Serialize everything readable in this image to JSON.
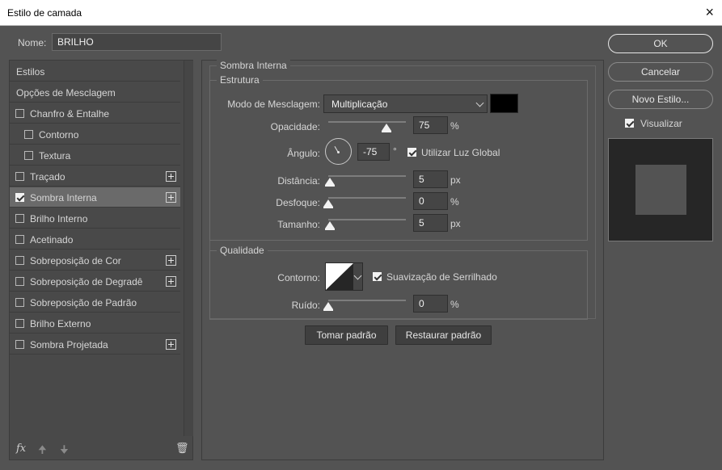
{
  "window": {
    "title": "Estilo de camada",
    "close_icon": "×"
  },
  "name_row": {
    "label": "Nome:",
    "value": "BRILHO"
  },
  "styles_list": [
    {
      "label": "Estilos",
      "checkbox": false,
      "checked": false,
      "plus": false,
      "indent": 0
    },
    {
      "label": "Opções de Mesclagem",
      "checkbox": false,
      "checked": false,
      "plus": false,
      "indent": 0
    },
    {
      "label": "Chanfro & Entalhe",
      "checkbox": true,
      "checked": false,
      "plus": false,
      "indent": 0
    },
    {
      "label": "Contorno",
      "checkbox": true,
      "checked": false,
      "plus": false,
      "indent": 1
    },
    {
      "label": "Textura",
      "checkbox": true,
      "checked": false,
      "plus": false,
      "indent": 1
    },
    {
      "label": "Traçado",
      "checkbox": true,
      "checked": false,
      "plus": true,
      "indent": 0
    },
    {
      "label": "Sombra Interna",
      "checkbox": true,
      "checked": true,
      "plus": true,
      "indent": 0,
      "selected": true
    },
    {
      "label": "Brilho Interno",
      "checkbox": true,
      "checked": false,
      "plus": false,
      "indent": 0
    },
    {
      "label": "Acetinado",
      "checkbox": true,
      "checked": false,
      "plus": false,
      "indent": 0
    },
    {
      "label": "Sobreposição de Cor",
      "checkbox": true,
      "checked": false,
      "plus": true,
      "indent": 0
    },
    {
      "label": "Sobreposição de Degradê",
      "checkbox": true,
      "checked": false,
      "plus": true,
      "indent": 0
    },
    {
      "label": "Sobreposição de Padrão",
      "checkbox": true,
      "checked": false,
      "plus": false,
      "indent": 0
    },
    {
      "label": "Brilho Externo",
      "checkbox": true,
      "checked": false,
      "plus": false,
      "indent": 0
    },
    {
      "label": "Sombra Projetada",
      "checkbox": true,
      "checked": false,
      "plus": true,
      "indent": 0
    }
  ],
  "bottom_icons": {
    "fx": "fx",
    "up": "🠉",
    "down": "🠋",
    "trash": "🗑"
  },
  "section": {
    "title": "Sombra Interna",
    "structure": {
      "title": "Estrutura",
      "blend_mode_label": "Modo de Mesclagem:",
      "blend_mode_value": "Multiplicação",
      "color_swatch": "#000000",
      "opacity_label": "Opacidade:",
      "opacity_value": "75",
      "opacity_unit": "%",
      "opacity_level": 0.75,
      "angle_label": "Ângulo:",
      "angle_value": "-75",
      "angle_unit": "°",
      "global_light_label": "Utilizar Luz Global",
      "global_light_checked": true,
      "distance_label": "Distância:",
      "distance_value": "5",
      "distance_unit": "px",
      "distance_level": 0.02,
      "blur_label": "Desfoque:",
      "blur_value": "0",
      "blur_unit": "%",
      "blur_level": 0,
      "size_label": "Tamanho:",
      "size_value": "5",
      "size_unit": "px",
      "size_level": 0.02
    },
    "quality": {
      "title": "Qualidade",
      "contour_label": "Contorno:",
      "antialias_label": "Suavização de Serrilhado",
      "antialias_checked": true,
      "noise_label": "Ruído:",
      "noise_value": "0",
      "noise_unit": "%",
      "noise_level": 0
    },
    "make_default_label": "Tomar padrão",
    "reset_default_label": "Restaurar padrão"
  },
  "right": {
    "ok_label": "OK",
    "cancel_label": "Cancelar",
    "new_style_label": "Novo Estilo...",
    "preview_label": "Visualizar",
    "preview_checked": true
  }
}
